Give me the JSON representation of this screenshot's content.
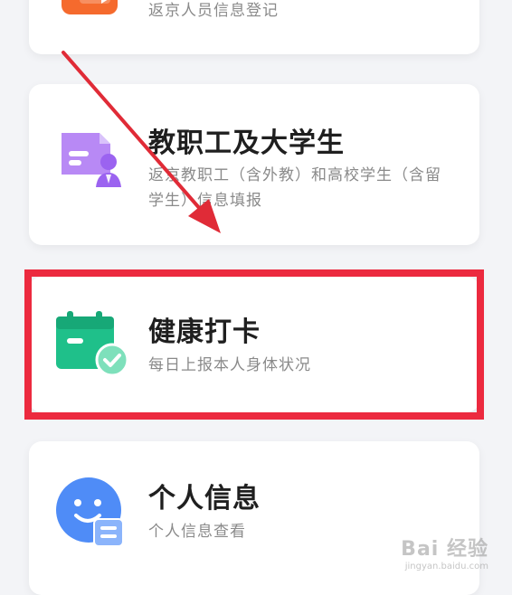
{
  "cards": [
    {
      "id": "return-beijing",
      "subtitle": "返京人员信息登记",
      "icon": "video-play-icon",
      "icon_color": "#f56a2d"
    },
    {
      "id": "staff-students",
      "title": "教职工及大学生",
      "subtitle": "返京教职工（含外教）和高校学生（含留学生）信息填报",
      "icon": "id-card-user-icon",
      "icon_color": "#9b63f0"
    },
    {
      "id": "health-checkin",
      "title": "健康打卡",
      "subtitle": "每日上报本人身体状况",
      "icon": "calendar-check-icon",
      "icon_color": "#1fc08a"
    },
    {
      "id": "personal-info",
      "title": "个人信息",
      "subtitle": "个人信息查看",
      "icon": "smiley-profile-icon",
      "icon_color": "#4f8cf7"
    }
  ],
  "annotation": {
    "highlight_color": "#ec2a3f",
    "arrow_color": "#e02b37"
  },
  "watermark": {
    "brand": "Bai 经验",
    "url": "jingyan.baidu.com"
  }
}
